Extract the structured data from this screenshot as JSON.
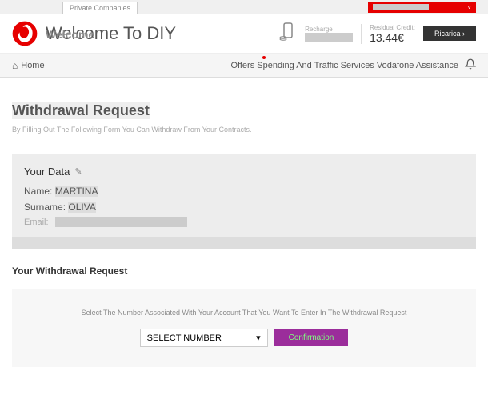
{
  "topbar": {
    "tab": "Private Companies"
  },
  "header": {
    "title": "Welcome To DIY",
    "ghost": "Welcome",
    "recharge_label": "Recharge",
    "credit_label": "Residual Credit:",
    "credit_value": "13.44€",
    "ricarica_btn": "Ricarica ›"
  },
  "nav": {
    "home": "Home",
    "menu": "Offers Spending And Traffic Services Vodafone Assistance"
  },
  "page": {
    "title": "Withdrawal Request",
    "desc": "By Filling Out The Following Form You Can Withdraw From Your Contracts."
  },
  "data": {
    "section_title": "Your Data",
    "name_label": "Name:",
    "name_value": "MARTINA",
    "surname_label": "Surname:",
    "surname_value": "OLIVA",
    "email_label": "Email:"
  },
  "request": {
    "title": "Your Withdrawal Request",
    "instruction": "Select The Number Associated With Your Account That You Want To Enter In The Withdrawal Request",
    "select_placeholder": "SELECT NUMBER",
    "confirm_btn": "Confirmation"
  }
}
